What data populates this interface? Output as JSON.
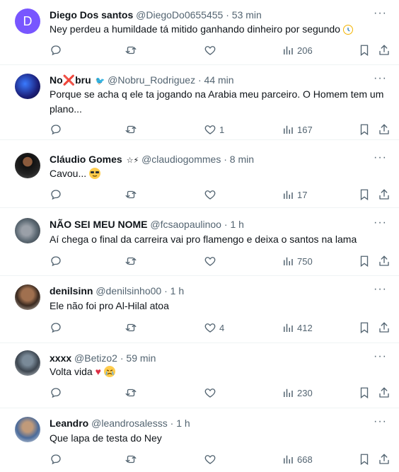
{
  "tweets": [
    {
      "avatar_letter": "D",
      "name": "Diego Dos santos",
      "badge": "",
      "handle": "@DiegoDo0655455",
      "dot": "·",
      "time": "53 min",
      "text": "Ney perdeu a humildade tá mitido ganhando dinheiro por segundo",
      "text_emoji": "clock-emoji",
      "replies": "",
      "retweets": "",
      "likes": "",
      "views": "206"
    },
    {
      "avatar_letter": "",
      "name": "No❌bru",
      "badge": "🐦",
      "handle": "@Nobru_Rodriguez",
      "dot": "·",
      "time": "44 min",
      "text": "Porque se acha q ele ta jogando na Arabia meu parceiro. O Homem tem um plano...",
      "text_emoji": "",
      "replies": "",
      "retweets": "",
      "likes": "1",
      "views": "167"
    },
    {
      "avatar_letter": "",
      "name": "Cláudio Gomes",
      "badge": "☆⚡",
      "handle": "@claudiogommes",
      "dot": "·",
      "time": "8 min",
      "text": "Cavou...",
      "text_emoji": "sunglasses-emoji",
      "replies": "",
      "retweets": "",
      "likes": "",
      "views": "17"
    },
    {
      "avatar_letter": "",
      "name": "NÃO SEI MEU NOME",
      "badge": "",
      "handle": "@fcsaopaulinoo",
      "dot": "·",
      "time": "1 h",
      "text": "Aí chega o final da carreira vai pro flamengo e deixa o santos na lama",
      "text_emoji": "",
      "replies": "",
      "retweets": "",
      "likes": "",
      "views": "750"
    },
    {
      "avatar_letter": "",
      "name": "denilsinn",
      "badge": "",
      "handle": "@denilsinho00",
      "dot": "·",
      "time": "1 h",
      "text": "Ele não foi pro Al-Hilal atoa",
      "text_emoji": "",
      "replies": "",
      "retweets": "",
      "likes": "4",
      "views": "412"
    },
    {
      "avatar_letter": "",
      "name": "xxxx",
      "badge": "",
      "handle": "@Betizo2",
      "dot": "·",
      "time": "59 min",
      "text": "Volta vida",
      "text_emoji": "heart-crying-emoji",
      "replies": "",
      "retweets": "",
      "likes": "",
      "views": "230"
    },
    {
      "avatar_letter": "",
      "name": "Leandro",
      "badge": "",
      "handle": "@leandrosalesss",
      "dot": "·",
      "time": "1 h",
      "text": "Que lapa de testa do Ney",
      "text_emoji": "",
      "replies": "",
      "retweets": "",
      "likes": "",
      "views": "668"
    }
  ],
  "more_label": "···",
  "colors": {
    "accent": "#1d9bf0",
    "muted": "#536471",
    "avatar_purple": "#7856ff"
  }
}
